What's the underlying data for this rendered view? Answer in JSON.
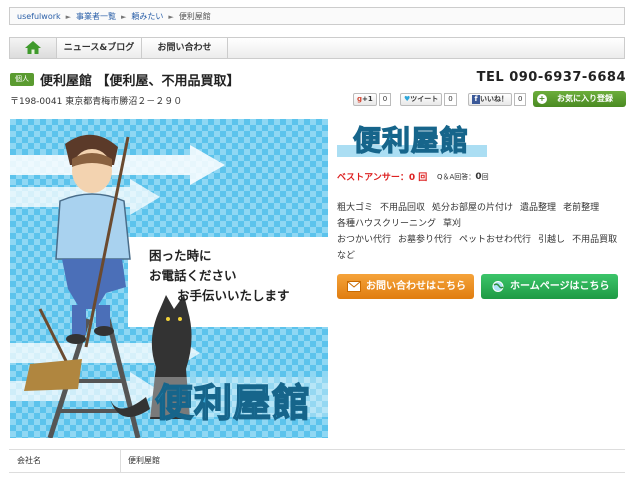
{
  "breadcrumb": {
    "items": [
      "usefulwork",
      "事業者一覧",
      "頼みたい",
      "便利屋館"
    ],
    "separator": "►"
  },
  "nav": {
    "home_icon": "house-icon",
    "items": [
      "ニュース&ブログ",
      "お問い合わせ"
    ]
  },
  "header": {
    "badge": "個人",
    "title": "便利屋館 【便利屋、不用品買取】",
    "tel": "TEL 090-6937-6684"
  },
  "address": "〒198-0041 東京都青梅市勝沼２－２９０",
  "social": {
    "gplus": {
      "label": "+1",
      "count": "0"
    },
    "tweet": {
      "label": "ツイート",
      "count": "0"
    },
    "like": {
      "label": "いいね！",
      "count": "0"
    },
    "favorite": "お気に入り登録"
  },
  "hero": {
    "message_lines": [
      "困った時に",
      "お電話ください",
      "お手伝いいたします"
    ],
    "logo_text": "便利屋館"
  },
  "right": {
    "logo_text": "便利屋館",
    "best_answer_label": "ベストアンサー：",
    "best_answer_count": "0 回",
    "qa_label": "Q＆A回答：",
    "qa_count": "0",
    "qa_unit": "回",
    "categories": [
      "粗大ゴミ",
      "不用品回収",
      "処分お部屋の片付け",
      "遺品整理",
      "老前整理",
      "各種ハウスクリーニング",
      "草刈",
      "おつかい代行",
      "お墓参り代行",
      "ペットおせわ代行",
      "引越し",
      "不用品買取",
      "など"
    ]
  },
  "buttons": {
    "contact": "お問い合わせはこちら",
    "homepage": "ホームページはこちら"
  },
  "info_table": {
    "company_label": "会社名",
    "company_value": "便利屋館"
  },
  "colors": {
    "accent_green": "#5a9b30",
    "orange": "#e8891c",
    "green_button": "#2bb356",
    "best_answer_red": "#d22222",
    "logo_blue": "#3aa7d6"
  }
}
